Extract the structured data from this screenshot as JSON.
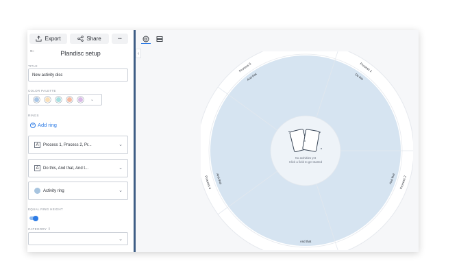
{
  "toolbar": {
    "export_label": "Export",
    "share_label": "Share",
    "more_label": "•••"
  },
  "sidebar": {
    "title": "Plandisc setup",
    "title_label": "TITLE",
    "title_value": "New activity disc",
    "palette_label": "COLOR PALETTE",
    "palette_colors": [
      "#a9c6e6",
      "#f9dfb8",
      "#a6dfe0",
      "#f5b9a1",
      "#d8b9e6"
    ],
    "rings_label": "RINGS",
    "add_ring_label": "Add ring",
    "rings": [
      {
        "label": "Process 1, Process 2, Pr...",
        "icon": "text-icon"
      },
      {
        "label": "Do this, And that, And t...",
        "icon": "text-icon"
      },
      {
        "label": "Activity ring",
        "icon": "activity-ring-icon"
      }
    ],
    "equal_label": "EQUAL RING HEIGHT",
    "category_label": "CATEGORY",
    "category_value": ""
  },
  "disc": {
    "outer_labels": [
      "Process 1",
      "Process 2",
      "Process 3",
      "Process 4",
      "Process 5"
    ],
    "inner_labels": [
      "Do this",
      "And that",
      "And that",
      "And that",
      "And that"
    ],
    "empty_title": "No activities yet",
    "empty_hint": "Click a field to get started",
    "colors": {
      "outer": "#ffffff",
      "inner": "#d6e4f1",
      "lines": "#e3e8ee",
      "hub": "#eef3f8"
    }
  }
}
